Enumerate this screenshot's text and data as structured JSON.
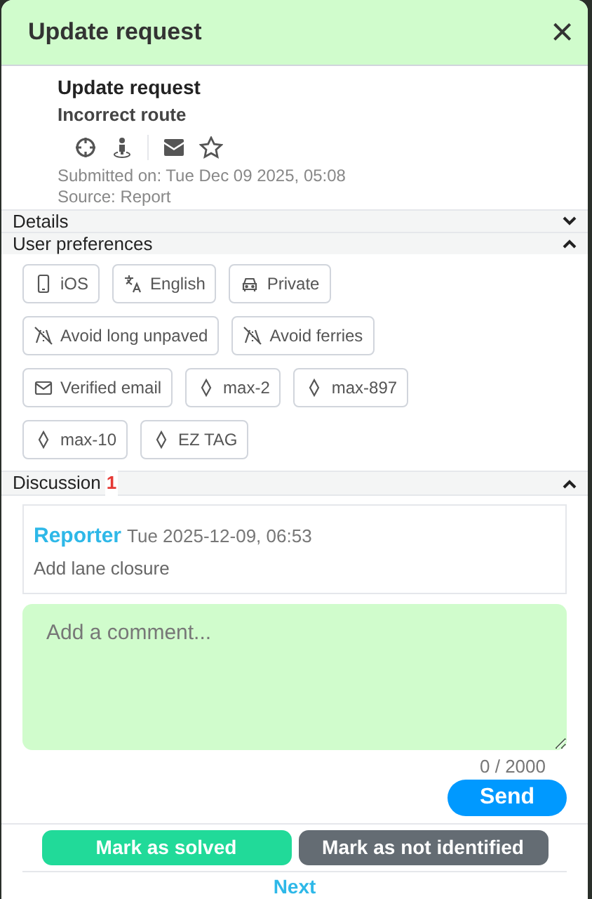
{
  "window": {
    "title": "Update request",
    "close": "×"
  },
  "request": {
    "title": "Update request",
    "subtitle": "Incorrect route",
    "submitted": "Submitted on: Tue Dec 09 2025, 05:08",
    "source": "Source: Report"
  },
  "sections": [
    {
      "label": "Details",
      "expanded": false
    },
    {
      "label": "User preferences",
      "expanded": true
    }
  ],
  "preferences": [
    {
      "kind": "phone",
      "label": "iOS"
    },
    {
      "kind": "language",
      "label": "English"
    },
    {
      "kind": "car",
      "label": "Private"
    },
    {
      "kind": "avoid",
      "label": "Avoid long unpaved"
    },
    {
      "kind": "avoid",
      "label": "Avoid ferries"
    },
    {
      "kind": "mail",
      "label": "Verified email"
    },
    {
      "kind": "tag",
      "label": "max-2"
    },
    {
      "kind": "tag",
      "label": "max-897"
    },
    {
      "kind": "tag",
      "label": "max-10"
    },
    {
      "kind": "tag",
      "label": "EZ TAG"
    }
  ],
  "discussion": {
    "label": "Discussion",
    "count": "1",
    "expanded": true,
    "comments": [
      {
        "author": "Reporter",
        "time": "Tue 2025-12-09, 06:53",
        "text": "Add lane closure"
      }
    ],
    "comment_field": {
      "placeholder": "Add a comment..."
    },
    "counter": "0 / 2000",
    "send": "Send"
  },
  "actions": [
    {
      "kind": "solved",
      "label": "Mark as solved"
    },
    {
      "kind": "not_identified",
      "label": "Mark as not identified"
    }
  ],
  "next": "Next"
}
